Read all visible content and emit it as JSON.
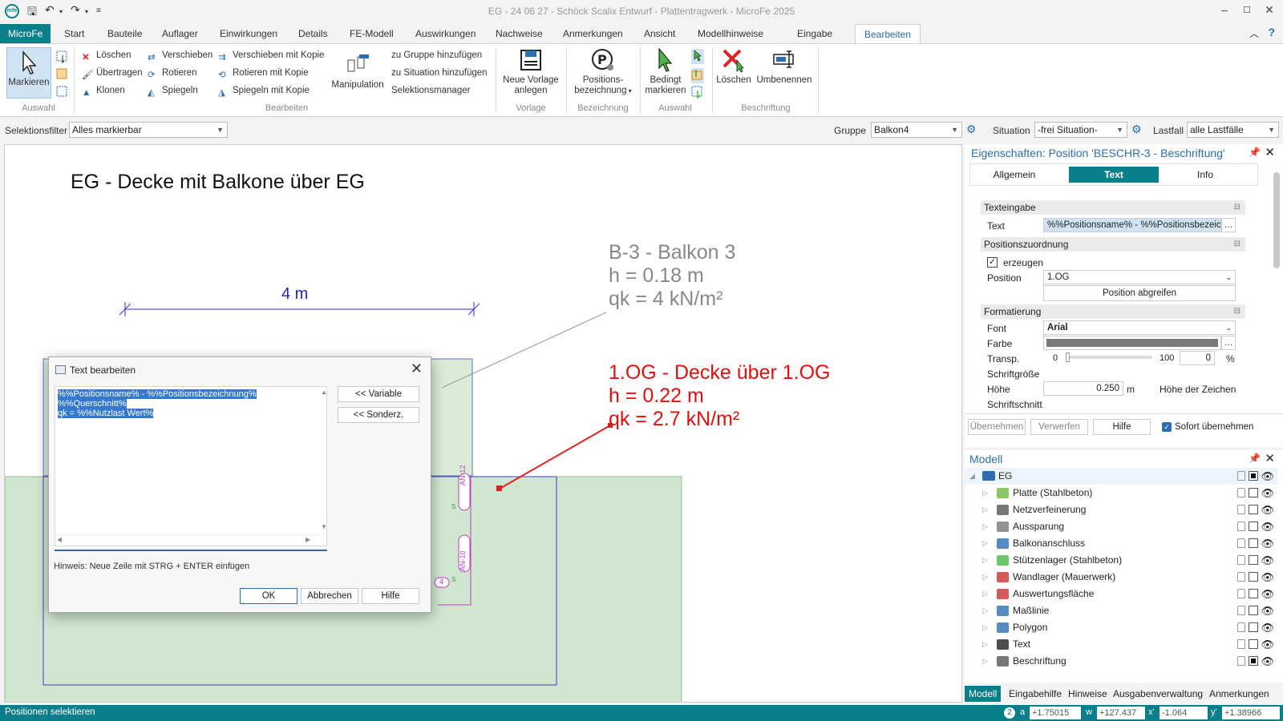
{
  "window": {
    "title": "EG - 24 06 27 - Schöck Scalix Entwurf - Plattentragwerk - MicroFe 2025"
  },
  "tabs": [
    "MicroFe",
    "Start",
    "Bauteile",
    "Auflager",
    "Einwirkungen",
    "Details",
    "FE-Modell",
    "Auswirkungen",
    "Nachweise",
    "Anmerkungen",
    "Ansicht",
    "Modellhinweise",
    "Eingabe",
    "Bearbeiten"
  ],
  "ribbon": {
    "markieren": "Markieren",
    "auswahl_group": "Auswahl",
    "loeschen": "Löschen",
    "uebertragen": "Übertragen",
    "klonen": "Klonen",
    "verschieben": "Verschieben",
    "rotieren": "Rotieren",
    "spiegeln": "Spiegeln",
    "verschieben_kopie": "Verschieben mit Kopie",
    "rotieren_kopie": "Rotieren mit Kopie",
    "spiegeln_kopie": "Spiegeln mit Kopie",
    "manipulation": "Manipulation",
    "zu_gruppe": "zu Gruppe hinzufügen",
    "zu_situation": "zu Situation hinzufügen",
    "selektionsmanager": "Selektionsmanager",
    "bearbeiten_group": "Bearbeiten",
    "neue_vorlage_1": "Neue Vorlage",
    "neue_vorlage_2": "anlegen",
    "vorlage_group": "Vorlage",
    "positions_1": "Positions-",
    "positions_2": "bezeichnung",
    "bezeichnung_group": "Bezeichnung",
    "bedingt_1": "Bedingt",
    "bedingt_2": "markieren",
    "auswahl_group2": "Auswahl",
    "loeschen2": "Löschen",
    "umbenennen": "Umbenennen",
    "beschriftung_group": "Beschriftung"
  },
  "filterbar": {
    "selektionsfilter_label": "Selektionsfilter",
    "selektionsfilter_value": "Alles markierbar",
    "gruppe_label": "Gruppe",
    "gruppe_value": "Balkon4",
    "situation_label": "Situation",
    "situation_value": "-frei Situation-",
    "lastfall_label": "Lastfall",
    "lastfall_value": "alle Lastfälle"
  },
  "drawing": {
    "heading": "EG - Decke mit Balkone über EG",
    "dimension": "4 m",
    "label_b3_1": "B-3 - Balkon 3",
    "label_b3_2": "h = 0.18 m",
    "label_b3_3": "qk = 4 kN/m²",
    "label_og_1": "1.OG - Decke über 1.OG",
    "label_og_2": "h = 0.22 m",
    "label_og_3": "qk = 2.7 kN/m²",
    "an12": "AN-12",
    "an10": "AN-10",
    "s1": "S",
    "s2": "S",
    "num4": "4"
  },
  "dialog": {
    "title": "Text bearbeiten",
    "lines": [
      "%%Positionsname% - %%Positionsbezeichnung%",
      "%%Querschnitt%",
      "qk = %%Nutzlast Wert%"
    ],
    "variable_btn": "<< Variable",
    "sonderz_btn": "<< Sonderz.",
    "hint": "Hinweis: Neue Zeile mit STRG + ENTER einfügen",
    "ok": "OK",
    "abbrechen": "Abbrechen",
    "hilfe": "Hilfe"
  },
  "properties": {
    "title": "Eigenschaften: Position 'BESCHR-3 - Beschriftung'",
    "tabs": [
      "Allgemein",
      "Text",
      "Info"
    ],
    "sec_texteingabe": "Texteingabe",
    "text_label": "Text",
    "text_value": "%%Positionsname% - %%Positionsbezeich",
    "sec_positionszuordnung": "Positionszuordnung",
    "erzeugen": "erzeugen",
    "position_label": "Position",
    "position_value": "1.OG",
    "position_abgreifen": "Position abgreifen",
    "sec_formatierung": "Formatierung",
    "font_label": "Font",
    "font_value": "Arial",
    "farbe_label": "Farbe",
    "transp_label": "Transp.",
    "transp_min": "0",
    "transp_max": "100",
    "transp_value": "0",
    "transp_unit": "%",
    "schriftgroesse_label": "Schriftgröße",
    "hoehe_label": "Höhe",
    "hoehe_value": "0.250",
    "hoehe_unit": "m",
    "hoehe_der_zeichen": "Höhe der Zeichen",
    "schriftschnitt_label": "Schriftschnitt",
    "uebernehmen": "Übernehmen",
    "verwerfen": "Verwerfen",
    "hilfe": "Hilfe",
    "sofort": "Sofort übernehmen"
  },
  "model": {
    "title": "Modell",
    "root": "EG",
    "items": [
      {
        "label": "Platte (Stahlbeton)",
        "checked": false,
        "icon": "slab-icon"
      },
      {
        "label": "Netzverfeinerung",
        "checked": false,
        "icon": "mesh-icon"
      },
      {
        "label": "Aussparung",
        "checked": false,
        "icon": "opening-icon"
      },
      {
        "label": "Balkonanschluss",
        "checked": false,
        "icon": "balcony-connection-icon"
      },
      {
        "label": "Stützenlager (Stahlbeton)",
        "checked": false,
        "icon": "column-support-icon"
      },
      {
        "label": "Wandlager (Mauerwerk)",
        "checked": false,
        "icon": "wall-support-icon"
      },
      {
        "label": "Auswertungsfläche",
        "checked": false,
        "icon": "evaluation-area-icon"
      },
      {
        "label": "Maßlinie",
        "checked": false,
        "icon": "dimension-line-icon"
      },
      {
        "label": "Polygon",
        "checked": false,
        "icon": "polygon-icon"
      },
      {
        "label": "Text",
        "checked": false,
        "icon": "text-icon"
      },
      {
        "label": "Beschriftung",
        "checked": true,
        "icon": "label-icon"
      }
    ]
  },
  "bottom_tabs": [
    "Modell",
    "Eingabehilfe",
    "Hinweise",
    "Ausgabenverwaltung",
    "Anmerkungen"
  ],
  "status": {
    "text": "Positionen selektieren",
    "badge": "2",
    "a_label": "a",
    "a_value": "+1.75015",
    "w_label": "w",
    "w_value": "+127.437",
    "x_label": "x'",
    "x_value": "-1.064",
    "y_label": "y'",
    "y_value": "+1.38966"
  }
}
